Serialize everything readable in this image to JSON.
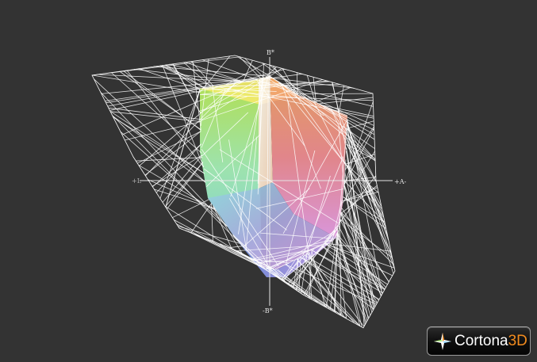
{
  "viewer": {
    "background": "#333333",
    "wire_color": "#ffffff",
    "axes": {
      "up_label": "B*",
      "right_label": "+A-",
      "down_label": "-B*",
      "left_label": "+L"
    }
  },
  "gamut_colors": {
    "yellow": "#f6ec55",
    "green": "#9ee46a",
    "cyan": "#8fe8dc",
    "blue": "#6f8fe0",
    "magenta": "#e79ae6",
    "red": "#f08a7f",
    "white": "#fbf7e8"
  },
  "logo": {
    "brand": "Cortona",
    "suffix": "3D",
    "accent": "#f28b1e",
    "mark_icon": "cortona-star-icon"
  }
}
